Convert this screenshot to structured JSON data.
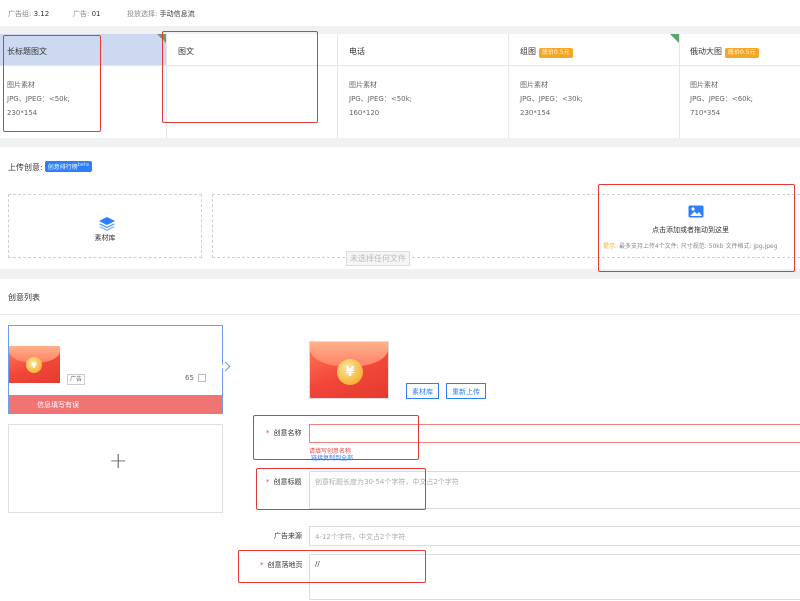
{
  "topbar": {
    "budget_label": "广告组:",
    "budget_value": "3.12",
    "ad_label": "广告:",
    "ad_value": "01",
    "mode_label": "投放选择:",
    "mode_value": "手动信息流"
  },
  "ad_types": [
    {
      "name": "长标题图文",
      "badge": "",
      "lines": [
        "图片素材",
        "JPG、JPEG：<50k;",
        "230*154"
      ]
    },
    {
      "name": "图文",
      "badge": "",
      "lines": []
    },
    {
      "name": "电话",
      "badge": "",
      "lines": [
        "图片素材",
        "JPG、JPEG：<50k;",
        "160*120"
      ]
    },
    {
      "name": "组图",
      "badge": "底价0.5元",
      "lines": [
        "图片素材",
        "JPG、JPEG：<30k;",
        "230*154"
      ]
    },
    {
      "name": "俄动大图",
      "badge": "底价0.5元",
      "lines": [
        "图片素材",
        "JPG、JPEG：<60k;",
        "710*354"
      ]
    }
  ],
  "upload": {
    "title": "上传创意:",
    "rank_pill": "创意排行榜",
    "beta": "beta",
    "library": "素材库",
    "no_file": "未选择任何文件",
    "drop_text": "点击添加或者拖动到这里",
    "hint_label": "提示:",
    "hint_text": "最多支持上传4个文件;  尺寸规范:  50kb  文件格式:  jpg,jpeg"
  },
  "list": {
    "title": "创意列表",
    "card": {
      "tag": "广告",
      "count": "65",
      "error": "信息填写有误"
    },
    "add": "+"
  },
  "editor": {
    "library_btn": "素材库",
    "reupload_btn": "重新上传",
    "name_label": "创意名称",
    "name_value": "",
    "name_error": "请填写创意名称",
    "name_hint": "链接复制到全部",
    "title_label": "创意标题",
    "title_placeholder": "创意标题长度为30-54个字符，中文占2个字符",
    "source_label": "广告来源",
    "source_placeholder": "4-12个字符，中文占2个字符",
    "landing_label": "创意落地页",
    "landing_value": "//"
  },
  "coin_glyph": "¥",
  "colors": {
    "accent": "#2d7ff9",
    "error": "#e54545",
    "active_tab": "#ccd9f0",
    "badge": "#f6a623"
  }
}
